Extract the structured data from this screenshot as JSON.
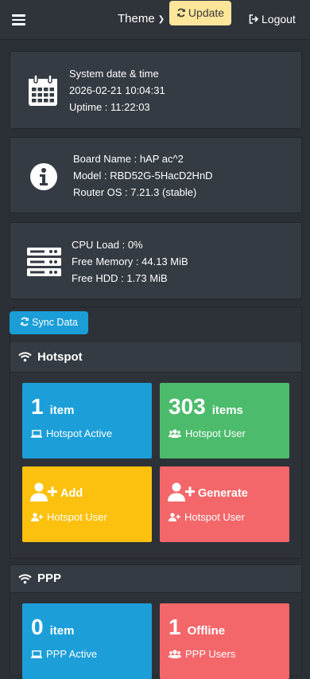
{
  "topbar": {
    "theme_label": "Theme",
    "update_label": "Update",
    "logout_label": "Logout"
  },
  "system": {
    "line1": "System date & time",
    "line2": "2026-02-21 10:04:31",
    "line3": "Uptime : 11:22:03"
  },
  "board": {
    "line1": "Board Name : hAP ac^2",
    "line2": "Model : RBD52G-5HacD2HnD",
    "line3": "Router OS : 7.21.3 (stable)"
  },
  "resources": {
    "line1": "CPU Load : 0%",
    "line2": "Free Memory : 44.13 MiB",
    "line3": "Free HDD : 1.73 MiB"
  },
  "sync_label": "Sync Data",
  "hotspot": {
    "title": "Hotspot",
    "active_count": "1",
    "active_unit": "item",
    "active_label": "Hotspot Active",
    "users_count": "303",
    "users_unit": "items",
    "users_label": "Hotspot User",
    "add_title": "Add",
    "add_label": "Hotspot User",
    "generate_title": "Generate",
    "generate_label": "Hotspot User"
  },
  "ppp": {
    "title": "PPP",
    "active_count": "0",
    "active_unit": "item",
    "active_label": "PPP Active",
    "offline_count": "1",
    "offline_unit": "Offline",
    "offline_label": "PPP Users"
  },
  "colors": {
    "blue": "#1c9fd9",
    "green": "#4cbb6c",
    "yellow": "#fcc10e",
    "red": "#f3676a",
    "update": "#fde59a"
  }
}
